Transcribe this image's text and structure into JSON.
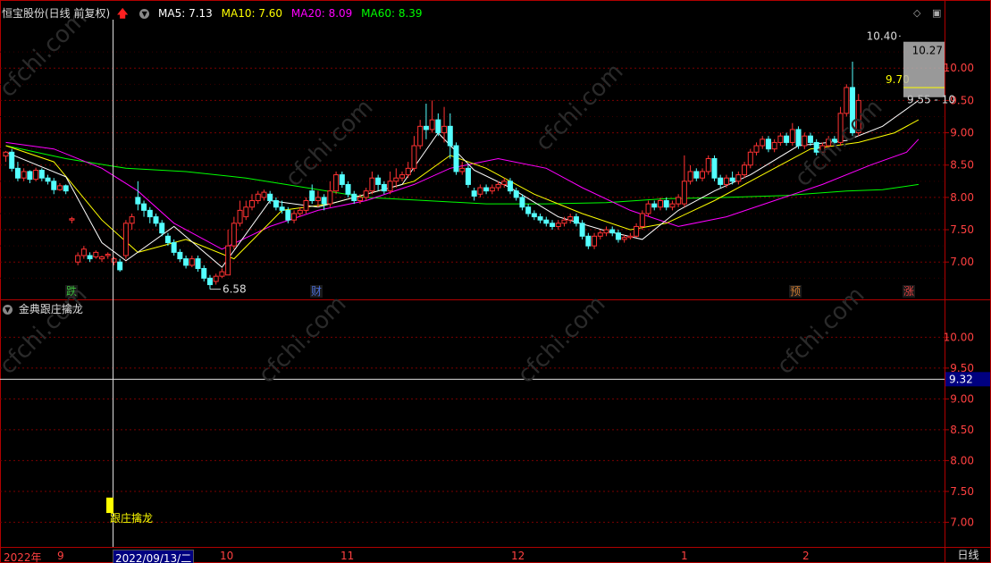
{
  "header": {
    "stock_title": "恒宝股份(日线 前复权)",
    "ma5": "MA5: 7.13",
    "ma10": "MA10: 7.60",
    "ma20": "MA20: 8.09",
    "ma60": "MA60: 8.39",
    "period": "日线"
  },
  "indicator": {
    "title": "金典跟庄擒龙",
    "signal_label": "跟庄擒龙",
    "cursor_value": "9.32"
  },
  "dates": {
    "year": "2022年",
    "cursor_date": "2022/09/13/二",
    "months": [
      "9",
      "10",
      "11",
      "12",
      "1",
      "2"
    ]
  },
  "markers": [
    {
      "label": "跌",
      "color": "#3cbf3c"
    },
    {
      "label": "财",
      "color": "#4a6cd4"
    },
    {
      "label": "预",
      "color": "#c87830"
    },
    {
      "label": "涨",
      "color": "#e04040"
    }
  ],
  "annotations": {
    "low": "6.58",
    "high": "10.40",
    "mid": "9.70",
    "range": "9.55 - 10",
    "box_value": "10.27"
  },
  "colors": {
    "up": "#ff3232",
    "down": "#54ffff",
    "ma5": "#ffffff",
    "ma10": "#ffff00",
    "ma20": "#ff00ff",
    "ma60": "#00ff00",
    "grid": "#7a0000",
    "axis": "#b00000"
  },
  "chart_data": {
    "type": "candlestick",
    "series_name": "恒宝股份",
    "price_axis": {
      "ticks": [
        7.0,
        7.5,
        8.0,
        8.5,
        9.0,
        9.5,
        10.0
      ],
      "ylim": [
        6.45,
        10.75
      ]
    },
    "indicator_axis": {
      "ticks": [
        7.0,
        7.5,
        8.0,
        8.5,
        9.0,
        9.5,
        10.0
      ],
      "ylim": [
        6.6,
        10.6
      ]
    },
    "candles": [
      [
        8.64,
        8.7,
        8.55,
        8.72
      ],
      [
        8.7,
        8.45,
        8.4,
        8.75
      ],
      [
        8.45,
        8.3,
        8.25,
        8.55
      ],
      [
        8.3,
        8.4,
        8.25,
        8.45
      ],
      [
        8.4,
        8.28,
        8.22,
        8.42
      ],
      [
        8.28,
        8.42,
        8.25,
        8.46
      ],
      [
        8.42,
        8.3,
        8.25,
        8.45
      ],
      [
        8.3,
        8.25,
        8.2,
        8.35
      ],
      [
        8.25,
        8.12,
        8.05,
        8.3
      ],
      [
        8.12,
        8.18,
        8.1,
        8.22
      ],
      [
        8.18,
        8.1,
        8.05,
        8.2
      ],
      [
        7.65,
        7.67,
        7.6,
        7.7
      ],
      [
        7.0,
        7.1,
        6.95,
        7.15
      ],
      [
        7.1,
        7.2,
        7.05,
        7.25
      ],
      [
        7.1,
        7.05,
        7.0,
        7.15
      ],
      [
        7.08,
        7.15,
        7.05,
        7.18
      ],
      [
        7.05,
        7.08,
        7.0,
        7.1
      ],
      [
        7.1,
        7.12,
        7.05,
        7.15
      ],
      [
        7.0,
        7.05,
        6.95,
        7.08
      ],
      [
        7.0,
        6.88,
        6.85,
        7.05
      ],
      [
        7.1,
        7.6,
        7.05,
        7.65
      ],
      [
        7.6,
        7.7,
        7.5,
        7.75
      ],
      [
        8.0,
        7.9,
        7.8,
        8.25
      ],
      [
        7.9,
        7.8,
        7.7,
        7.95
      ],
      [
        7.8,
        7.7,
        7.6,
        7.85
      ],
      [
        7.7,
        7.6,
        7.55,
        7.75
      ],
      [
        7.6,
        7.45,
        7.4,
        7.65
      ],
      [
        7.4,
        7.3,
        7.25,
        7.45
      ],
      [
        7.3,
        7.15,
        7.1,
        7.35
      ],
      [
        7.15,
        7.05,
        7.0,
        7.2
      ],
      [
        7.05,
        6.95,
        6.9,
        7.1
      ],
      [
        6.95,
        7.05,
        6.92,
        7.1
      ],
      [
        7.05,
        6.9,
        6.85,
        7.1
      ],
      [
        6.9,
        6.75,
        6.7,
        6.95
      ],
      [
        6.75,
        6.65,
        6.58,
        6.8
      ],
      [
        6.7,
        6.78,
        6.65,
        6.82
      ],
      [
        6.78,
        6.85,
        6.75,
        6.9
      ],
      [
        6.8,
        7.25,
        6.8,
        7.5
      ],
      [
        7.25,
        7.6,
        7.2,
        7.7
      ],
      [
        7.6,
        7.8,
        7.55,
        7.95
      ],
      [
        7.7,
        7.85,
        7.65,
        7.95
      ],
      [
        7.85,
        7.95,
        7.8,
        8.05
      ],
      [
        7.95,
        8.05,
        7.9,
        8.1
      ],
      [
        8.0,
        8.08,
        7.95,
        8.12
      ],
      [
        8.05,
        7.95,
        7.9,
        8.1
      ],
      [
        7.95,
        7.85,
        7.8,
        8.0
      ],
      [
        7.85,
        7.8,
        7.75,
        7.95
      ],
      [
        7.8,
        7.65,
        7.6,
        7.85
      ],
      [
        7.65,
        7.75,
        7.6,
        7.8
      ],
      [
        7.75,
        7.8,
        7.7,
        7.85
      ],
      [
        7.8,
        7.95,
        7.75,
        8.0
      ],
      [
        8.1,
        7.95,
        7.9,
        8.2
      ],
      [
        7.95,
        8.0,
        7.85,
        8.1
      ],
      [
        8.0,
        7.9,
        7.8,
        8.05
      ],
      [
        7.9,
        8.1,
        7.85,
        8.25
      ],
      [
        8.1,
        8.35,
        8.05,
        8.4
      ],
      [
        8.35,
        8.2,
        8.15,
        8.4
      ],
      [
        8.2,
        8.05,
        8.0,
        8.25
      ],
      [
        8.05,
        7.95,
        7.9,
        8.1
      ],
      [
        7.95,
        8.0,
        7.9,
        8.05
      ],
      [
        8.0,
        8.1,
        7.95,
        8.15
      ],
      [
        8.1,
        8.3,
        8.05,
        8.4
      ],
      [
        8.3,
        8.2,
        8.1,
        8.35
      ],
      [
        8.2,
        8.1,
        8.05,
        8.25
      ],
      [
        8.1,
        8.25,
        8.05,
        8.4
      ],
      [
        8.25,
        8.3,
        8.15,
        8.45
      ],
      [
        8.3,
        8.35,
        8.25,
        8.4
      ],
      [
        8.35,
        8.45,
        8.3,
        8.55
      ],
      [
        8.45,
        8.8,
        8.4,
        8.95
      ],
      [
        8.8,
        9.1,
        8.75,
        9.2
      ],
      [
        9.1,
        9.05,
        8.9,
        9.45
      ],
      [
        9.05,
        9.2,
        9.0,
        9.5
      ],
      [
        9.2,
        9.0,
        8.95,
        9.3
      ],
      [
        9.0,
        9.1,
        8.85,
        9.4
      ],
      [
        9.1,
        8.8,
        8.6,
        9.3
      ],
      [
        8.8,
        8.4,
        8.35,
        8.85
      ],
      [
        8.4,
        8.45,
        8.35,
        8.55
      ],
      [
        8.45,
        8.2,
        8.15,
        8.5
      ],
      [
        8.1,
        8.02,
        7.95,
        8.15
      ],
      [
        8.05,
        8.15,
        8.0,
        8.2
      ],
      [
        8.15,
        8.1,
        8.05,
        8.2
      ],
      [
        8.1,
        8.15,
        8.05,
        8.2
      ],
      [
        8.15,
        8.2,
        8.1,
        8.25
      ],
      [
        8.2,
        8.25,
        8.15,
        8.3
      ],
      [
        8.25,
        8.1,
        8.05,
        8.3
      ],
      [
        8.1,
        8.0,
        7.95,
        8.15
      ],
      [
        8.0,
        7.85,
        7.8,
        8.05
      ],
      [
        7.85,
        7.75,
        7.7,
        7.9
      ],
      [
        7.75,
        7.7,
        7.65,
        7.8
      ],
      [
        7.7,
        7.65,
        7.6,
        7.75
      ],
      [
        7.65,
        7.6,
        7.55,
        7.7
      ],
      [
        7.6,
        7.55,
        7.5,
        7.65
      ],
      [
        7.55,
        7.6,
        7.5,
        7.65
      ],
      [
        7.6,
        7.65,
        7.55,
        7.7
      ],
      [
        7.65,
        7.7,
        7.6,
        7.75
      ],
      [
        7.7,
        7.6,
        7.55,
        7.75
      ],
      [
        7.6,
        7.4,
        7.35,
        7.65
      ],
      [
        7.4,
        7.25,
        7.2,
        7.45
      ],
      [
        7.25,
        7.4,
        7.2,
        7.45
      ],
      [
        7.4,
        7.45,
        7.35,
        7.5
      ],
      [
        7.45,
        7.5,
        7.4,
        7.55
      ],
      [
        7.5,
        7.45,
        7.4,
        7.55
      ],
      [
        7.45,
        7.35,
        7.3,
        7.5
      ],
      [
        7.35,
        7.38,
        7.3,
        7.42
      ],
      [
        7.38,
        7.4,
        7.35,
        7.45
      ],
      [
        7.4,
        7.55,
        7.38,
        7.6
      ],
      [
        7.55,
        7.75,
        7.5,
        7.8
      ],
      [
        7.75,
        7.9,
        7.7,
        7.95
      ],
      [
        7.9,
        7.85,
        7.8,
        7.95
      ],
      [
        7.85,
        7.95,
        7.8,
        8.0
      ],
      [
        7.95,
        7.85,
        7.8,
        8.0
      ],
      [
        7.85,
        7.9,
        7.8,
        7.95
      ],
      [
        7.9,
        8.0,
        7.85,
        8.05
      ],
      [
        7.9,
        8.25,
        7.85,
        8.65
      ],
      [
        8.25,
        8.4,
        8.2,
        8.5
      ],
      [
        8.4,
        8.3,
        8.25,
        8.45
      ],
      [
        8.3,
        8.4,
        8.25,
        8.45
      ],
      [
        8.4,
        8.6,
        8.35,
        8.65
      ],
      [
        8.6,
        8.3,
        8.25,
        8.65
      ],
      [
        8.3,
        8.2,
        8.15,
        8.35
      ],
      [
        8.2,
        8.3,
        8.15,
        8.35
      ],
      [
        8.3,
        8.25,
        8.2,
        8.4
      ],
      [
        8.25,
        8.35,
        8.2,
        8.4
      ],
      [
        8.35,
        8.5,
        8.3,
        8.55
      ],
      [
        8.5,
        8.7,
        8.45,
        8.75
      ],
      [
        8.7,
        8.8,
        8.65,
        8.85
      ],
      [
        8.8,
        8.9,
        8.75,
        8.95
      ],
      [
        8.9,
        8.75,
        8.7,
        8.95
      ],
      [
        8.75,
        8.85,
        8.7,
        8.9
      ],
      [
        8.85,
        8.95,
        8.8,
        9.0
      ],
      [
        8.95,
        8.85,
        8.8,
        9.0
      ],
      [
        8.85,
        9.05,
        8.8,
        9.15
      ],
      [
        9.05,
        8.8,
        8.75,
        9.1
      ],
      [
        8.8,
        8.95,
        8.75,
        9.0
      ],
      [
        8.95,
        8.85,
        8.8,
        9.0
      ],
      [
        8.85,
        8.7,
        8.65,
        8.9
      ],
      [
        8.7,
        8.8,
        8.65,
        8.85
      ],
      [
        8.8,
        8.9,
        8.75,
        8.95
      ],
      [
        8.9,
        8.85,
        8.8,
        8.95
      ],
      [
        8.85,
        9.3,
        8.8,
        9.4
      ],
      [
        9.3,
        9.7,
        9.25,
        9.75
      ],
      [
        9.7,
        9.0,
        8.95,
        10.1
      ],
      [
        9.0,
        9.5,
        8.95,
        9.6
      ]
    ],
    "ma_lines": {
      "ma5": [
        [
          0,
          8.7
        ],
        [
          10,
          8.32
        ],
        [
          16,
          7.3
        ],
        [
          20,
          7.02
        ],
        [
          28,
          7.55
        ],
        [
          36,
          6.92
        ],
        [
          44,
          7.95
        ],
        [
          52,
          7.85
        ],
        [
          60,
          8.05
        ],
        [
          66,
          8.2
        ],
        [
          72,
          9.0
        ],
        [
          78,
          8.42
        ],
        [
          84,
          8.15
        ],
        [
          92,
          7.7
        ],
        [
          100,
          7.48
        ],
        [
          106,
          7.35
        ],
        [
          112,
          7.8
        ],
        [
          118,
          8.1
        ],
        [
          124,
          8.35
        ],
        [
          132,
          8.8
        ],
        [
          140,
          8.88
        ],
        [
          146,
          9.1
        ],
        [
          152,
          9.5
        ]
      ],
      "ma10": [
        [
          0,
          8.8
        ],
        [
          8,
          8.55
        ],
        [
          16,
          7.65
        ],
        [
          22,
          7.15
        ],
        [
          30,
          7.35
        ],
        [
          38,
          7.05
        ],
        [
          46,
          7.8
        ],
        [
          54,
          7.9
        ],
        [
          62,
          8.1
        ],
        [
          68,
          8.25
        ],
        [
          74,
          8.65
        ],
        [
          80,
          8.45
        ],
        [
          88,
          8.05
        ],
        [
          96,
          7.75
        ],
        [
          104,
          7.5
        ],
        [
          110,
          7.6
        ],
        [
          118,
          7.95
        ],
        [
          126,
          8.35
        ],
        [
          134,
          8.75
        ],
        [
          142,
          8.85
        ],
        [
          148,
          9.0
        ],
        [
          152,
          9.2
        ]
      ],
      "ma20": [
        [
          0,
          8.85
        ],
        [
          8,
          8.75
        ],
        [
          16,
          8.45
        ],
        [
          22,
          8.1
        ],
        [
          28,
          7.6
        ],
        [
          36,
          7.2
        ],
        [
          44,
          7.55
        ],
        [
          52,
          7.8
        ],
        [
          60,
          7.95
        ],
        [
          68,
          8.2
        ],
        [
          74,
          8.45
        ],
        [
          82,
          8.6
        ],
        [
          90,
          8.45
        ],
        [
          96,
          8.15
        ],
        [
          104,
          7.8
        ],
        [
          112,
          7.55
        ],
        [
          120,
          7.7
        ],
        [
          128,
          7.95
        ],
        [
          136,
          8.2
        ],
        [
          144,
          8.5
        ],
        [
          150,
          8.7
        ],
        [
          152,
          8.9
        ]
      ],
      "ma60": [
        [
          0,
          8.8
        ],
        [
          10,
          8.6
        ],
        [
          20,
          8.45
        ],
        [
          30,
          8.4
        ],
        [
          40,
          8.3
        ],
        [
          50,
          8.15
        ],
        [
          60,
          8.0
        ],
        [
          70,
          7.95
        ],
        [
          80,
          7.9
        ],
        [
          90,
          7.9
        ],
        [
          100,
          7.92
        ],
        [
          110,
          7.98
        ],
        [
          120,
          8.0
        ],
        [
          130,
          8.03
        ],
        [
          140,
          8.1
        ],
        [
          146,
          8.12
        ],
        [
          152,
          8.2
        ]
      ]
    },
    "signal_bar": {
      "index": 20,
      "from": 7.15,
      "to": 7.4
    }
  }
}
